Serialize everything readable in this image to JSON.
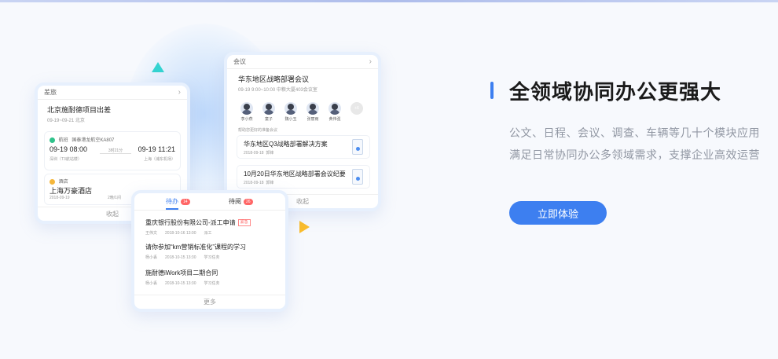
{
  "hero": {
    "title": "全领域协同办公更强大",
    "desc_line1": "公文、日程、会议、调查、车辆等几十个模块应用",
    "desc_line2": "满足日常协同办公多领域需求，支撑企业高效运营",
    "cta_label": "立即体验",
    "accent_color": "#3d7ff0"
  },
  "travel_card": {
    "header": "差旅",
    "trip_title": "北京施耐德项目出差",
    "trip_meta": "09-19~09-21  北京",
    "flight": {
      "type_label": "航班",
      "route": "国泰港龙航空KA807",
      "depart_time": "09-19 08:00",
      "arrive_time": "09-19 11:21",
      "depart_place": "深圳（T3航站楼）",
      "arrive_place": "上海（浦东机场）",
      "duration": "3时21分"
    },
    "hotel": {
      "type_label": "酒店",
      "name": "上海万豪酒店",
      "date": "2018-09-19",
      "nights": "2晚/1间"
    },
    "footer": "收起"
  },
  "meeting_card": {
    "header": "会议",
    "title": "华东地区战略部署会议",
    "meta": "09-19  9:00~10:00    中粮大厦403会议室",
    "attendees": [
      "李小燕",
      "童子",
      "魏小玉",
      "张丽雨",
      "黄伟强"
    ],
    "more": "+6",
    "docs_label": "帮助您更好的准备会议",
    "docs": [
      {
        "title": "华东地区Q3战略部署解决方案",
        "date": "2018-09-18",
        "author": "郭锋"
      },
      {
        "title": "10月20日华东地区战略部署会议纪要",
        "date": "2018-09-18",
        "author": "郭锋"
      }
    ],
    "footer": "收起"
  },
  "todo_card": {
    "tab_todo": "待办",
    "tab_todo_count": "14",
    "tab_read": "待阅",
    "tab_read_count": "26",
    "tasks": [
      {
        "title": "重庆银行股份有限公司-派工申请",
        "tag": "紧急",
        "user": "王伟文",
        "time": "2018-10-16 13:00",
        "type": "派工"
      },
      {
        "title": "请你参加“km营销标准化”课程的学习",
        "tag": "",
        "user": "杨小丢",
        "time": "2018-10-15 13:30",
        "type": "学习任务"
      },
      {
        "title": "施耐德iWork项目二期合同",
        "tag": "",
        "user": "杨小丢",
        "time": "2018-10-15 13:30",
        "type": "学习任务"
      }
    ],
    "footer": "更多"
  }
}
